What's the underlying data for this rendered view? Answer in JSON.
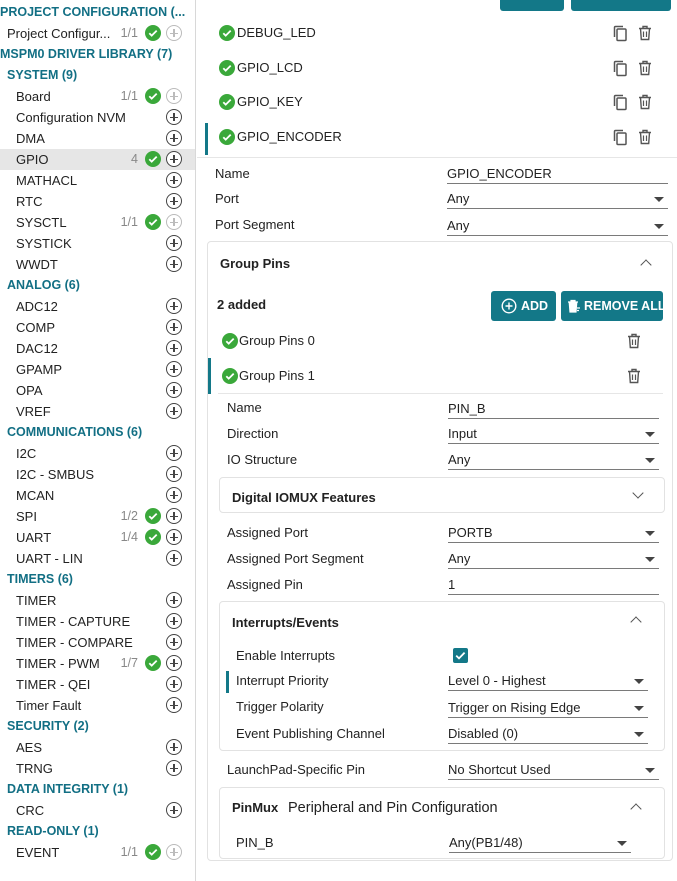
{
  "sidebar": {
    "project_configuration": {
      "header": "PROJECT CONFIGURATION (...",
      "item_label": "Project Configur...",
      "item_count": "1/1"
    },
    "driver_library_header": "MSPM0 DRIVER LIBRARY (7)",
    "categories": [
      {
        "header": "SYSTEM (9)",
        "items": [
          {
            "label": "Board",
            "count": "1/1",
            "check": true,
            "dim": true
          },
          {
            "label": "Configuration NVM"
          },
          {
            "label": "DMA"
          },
          {
            "label": "GPIO",
            "count": "4",
            "check": true,
            "selected": true
          },
          {
            "label": "MATHACL"
          },
          {
            "label": "RTC"
          },
          {
            "label": "SYSCTL",
            "count": "1/1",
            "check": true,
            "dim": true
          },
          {
            "label": "SYSTICK"
          },
          {
            "label": "WWDT"
          }
        ]
      },
      {
        "header": "ANALOG (6)",
        "items": [
          {
            "label": "ADC12"
          },
          {
            "label": "COMP"
          },
          {
            "label": "DAC12"
          },
          {
            "label": "GPAMP"
          },
          {
            "label": "OPA"
          },
          {
            "label": "VREF"
          }
        ]
      },
      {
        "header": "COMMUNICATIONS (6)",
        "items": [
          {
            "label": "I2C"
          },
          {
            "label": "I2C - SMBUS"
          },
          {
            "label": "MCAN"
          },
          {
            "label": "SPI",
            "count": "1/2",
            "check": true
          },
          {
            "label": "UART",
            "count": "1/4",
            "check": true
          },
          {
            "label": "UART - LIN"
          }
        ]
      },
      {
        "header": "TIMERS (6)",
        "items": [
          {
            "label": "TIMER"
          },
          {
            "label": "TIMER - CAPTURE"
          },
          {
            "label": "TIMER - COMPARE"
          },
          {
            "label": "TIMER - PWM",
            "count": "1/7",
            "check": true
          },
          {
            "label": "TIMER - QEI"
          },
          {
            "label": "Timer Fault"
          }
        ]
      },
      {
        "header": "SECURITY (2)",
        "items": [
          {
            "label": "AES"
          },
          {
            "label": "TRNG"
          }
        ]
      },
      {
        "header": "DATA INTEGRITY (1)",
        "items": [
          {
            "label": "CRC"
          }
        ]
      },
      {
        "header": "READ-ONLY (1)",
        "items": [
          {
            "label": "EVENT",
            "count": "1/1",
            "check": true,
            "dim": true
          }
        ]
      }
    ]
  },
  "instances": [
    "DEBUG_LED",
    "GPIO_LCD",
    "GPIO_KEY",
    "GPIO_ENCODER"
  ],
  "instance_fields": {
    "name_label": "Name",
    "name_value": "GPIO_ENCODER",
    "port_label": "Port",
    "port_value": "Any",
    "segment_label": "Port Segment",
    "segment_value": "Any"
  },
  "group_pins": {
    "title": "Group Pins",
    "added_count": "2 added",
    "add_label": "ADD",
    "remove_all_label": "REMOVE ALL",
    "items": [
      "Group Pins 0",
      "Group Pins 1"
    ]
  },
  "pin_fields": {
    "name_label": "Name",
    "name_value": "PIN_B",
    "direction_label": "Direction",
    "direction_value": "Input",
    "io_label": "IO Structure",
    "io_value": "Any"
  },
  "iomux": {
    "title": "Digital IOMUX Features"
  },
  "assigned": {
    "port_label": "Assigned Port",
    "port_value": "PORTB",
    "segment_label": "Assigned Port Segment",
    "segment_value": "Any",
    "pin_label": "Assigned Pin",
    "pin_value": "1"
  },
  "interrupts": {
    "title": "Interrupts/Events",
    "enable_label": "Enable Interrupts",
    "enable_checked": true,
    "priority_label": "Interrupt Priority",
    "priority_value": "Level 0 - Highest",
    "polarity_label": "Trigger Polarity",
    "polarity_value": "Trigger on Rising Edge",
    "publish_label": "Event Publishing Channel",
    "publish_value": "Disabled (0)"
  },
  "launchpad": {
    "label": "LaunchPad-Specific Pin",
    "value": "No Shortcut Used"
  },
  "pinmux": {
    "badge": "PinMux",
    "title": "Peripheral and Pin Configuration",
    "pin_label": "PIN_B",
    "pin_value": "Any(PB1/48)"
  },
  "colors": {
    "accent": "#137888",
    "check_green": "#3aa83a",
    "header_teal": "#126f84"
  }
}
